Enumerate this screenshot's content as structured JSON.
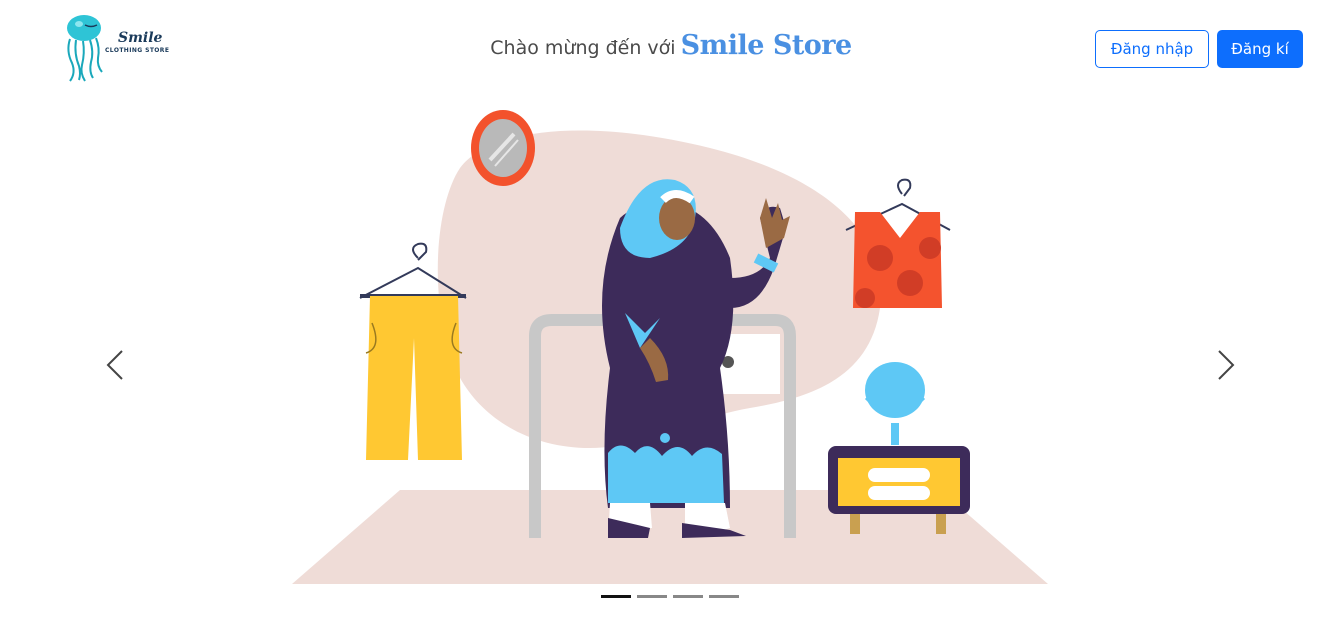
{
  "logo": {
    "line1": "Smile",
    "line2": "CLOTHING STORE",
    "icon": "jellyfish-icon"
  },
  "header": {
    "welcome_prefix": "Chào mừng đến với",
    "brand_name": "Smile Store"
  },
  "auth": {
    "login_label": "Đăng nhập",
    "register_label": "Đăng kí"
  },
  "carousel": {
    "prev_icon": "chevron-left-icon",
    "next_icon": "chevron-right-icon",
    "slide_count": 4,
    "active_index": 0
  },
  "colors": {
    "primary": "#0d6efd",
    "brand_text": "#4a90e2",
    "blob": "#efdcd7"
  }
}
